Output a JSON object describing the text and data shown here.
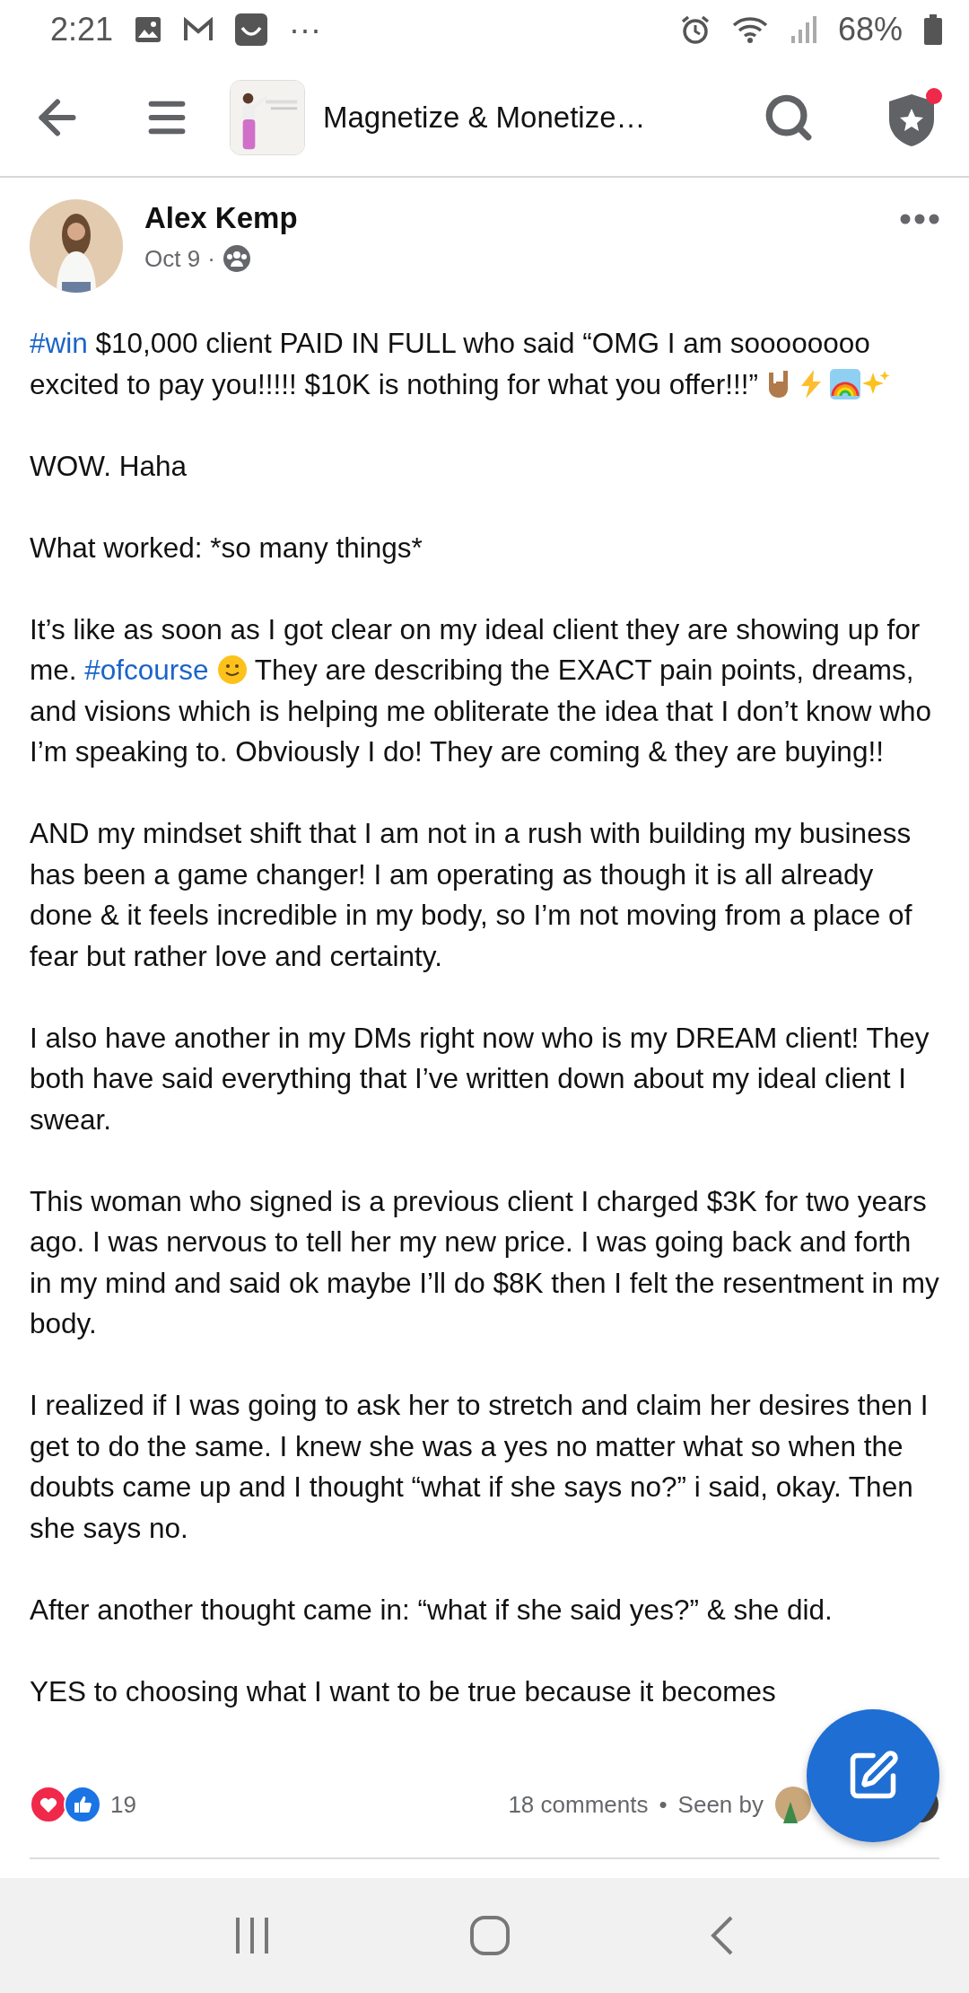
{
  "status_bar": {
    "time": "2:21",
    "more": "···",
    "battery": "68%"
  },
  "header": {
    "title": "Magnetize & Monetize…",
    "notification_badge": true
  },
  "post": {
    "author": "Alex Kemp",
    "date": "Oct 9",
    "separator": "·",
    "paragraphs": [
      [
        {
          "kind": "hashtag",
          "text": "#win"
        },
        {
          "kind": "text",
          "text": " $10,000 client PAID IN FULL who said “OMG I am soooooooo excited to pay you!!!!! $10K is nothing for what you offer!!!”"
        },
        {
          "kind": "horns"
        },
        {
          "kind": "bolt"
        },
        {
          "kind": "rainbow"
        },
        {
          "kind": "sparkles"
        }
      ],
      [
        {
          "kind": "text",
          "text": "WOW. Haha"
        }
      ],
      [
        {
          "kind": "text",
          "text": "What worked: *so many things*"
        }
      ],
      [
        {
          "kind": "text",
          "text": "It’s like as soon as I got clear on my ideal client they are showing up for me. "
        },
        {
          "kind": "hashtag",
          "text": "#ofcourse"
        },
        {
          "kind": "smile"
        },
        {
          "kind": "text",
          "text": " They are describing the EXACT pain points, dreams, and visions which is helping me obliterate the idea that I don’t know who I’m speaking to. Obviously I do! They are coming & they are buying!!"
        }
      ],
      [
        {
          "kind": "text",
          "text": "AND my mindset shift that I am not in a rush with building my business has been a game changer! I am operating as though it is all already done & it feels incredible in my body, so I’m not moving from a place of fear but rather love and certainty."
        }
      ],
      [
        {
          "kind": "text",
          "text": "I also have another in my DMs right now who is my DREAM client! They both have said everything that I’ve written down about my ideal client I swear."
        }
      ],
      [
        {
          "kind": "text",
          "text": "This woman who signed is a previous client I charged $3K for two years ago. I was nervous to tell her my new price. I was going back and forth in my mind and said ok maybe I’ll do $8K then I felt the resentment in my body."
        }
      ],
      [
        {
          "kind": "text",
          "text": "I realized if I was going to ask her to stretch and claim her desires then I get to do the same. I knew she was a yes no matter what so when the doubts came up and I thought “what if she says no?” i said, okay. Then she says no."
        }
      ],
      [
        {
          "kind": "text",
          "text": "After another thought came in: “what if she said yes?” & she did."
        }
      ],
      [
        {
          "kind": "text",
          "text": "YES to choosing what I want to be true because it becomes"
        }
      ]
    ],
    "reaction_count": "19",
    "comments": "18 comments",
    "dot": "•",
    "seen_by": "Seen by"
  }
}
